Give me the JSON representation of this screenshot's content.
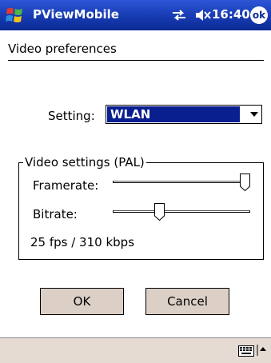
{
  "titlebar": {
    "app_title": "PViewMobile",
    "time": "16:40",
    "ok_label": "ok",
    "start_icon": "windows-start-flag-icon",
    "connectivity_icon": "connectivity-arrows-icon",
    "volume_icon": "speaker-muted-icon"
  },
  "page": {
    "header": "Video preferences"
  },
  "setting": {
    "label": "Setting:",
    "selected": "WLAN"
  },
  "video_group": {
    "legend": "Video settings (PAL)",
    "framerate_label": "Framerate:",
    "framerate_level": 1.0,
    "bitrate_label": "Bitrate:",
    "bitrate_level": 0.33,
    "summary": "25 fps / 310 kbps"
  },
  "buttons": {
    "ok": "OK",
    "cancel": "Cancel"
  },
  "bottombar": {
    "keyboard_icon": "keyboard-icon",
    "sip_arrow_icon": "up-arrow-icon"
  },
  "colors": {
    "titlebar": "#1a3fb8",
    "selection": "#0a1f8f",
    "button_face": "#dccfc6",
    "bottombar": "#e6dbd3"
  }
}
